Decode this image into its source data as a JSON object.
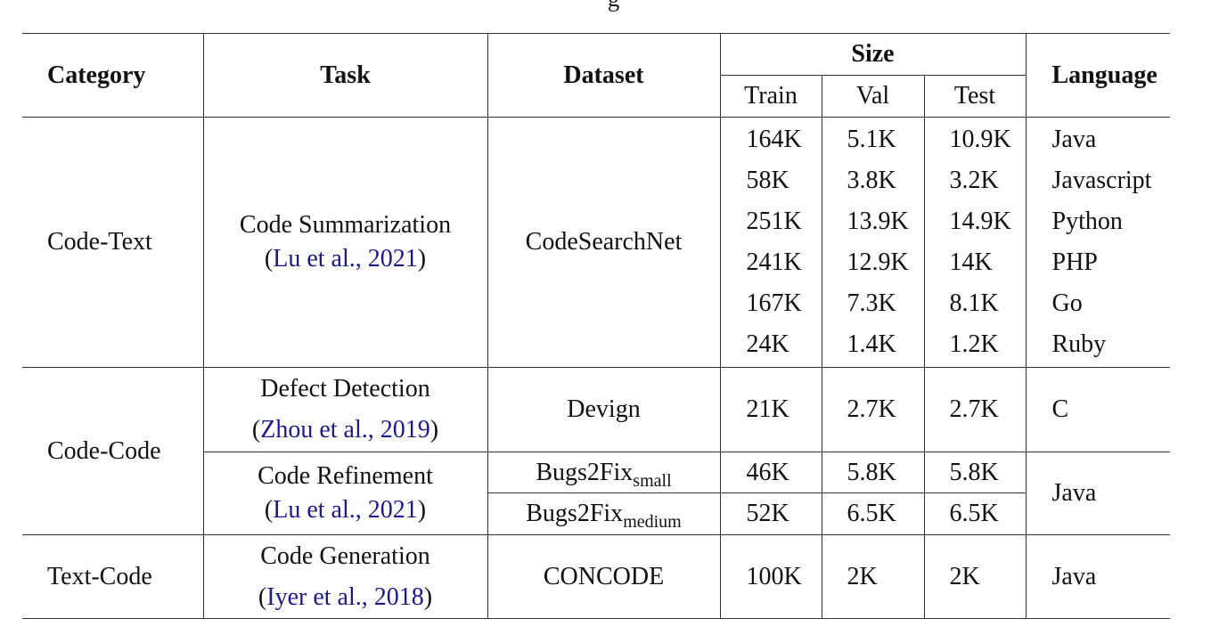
{
  "caption_fragment": "g",
  "header": {
    "category": "Category",
    "task": "Task",
    "dataset": "Dataset",
    "size": "Size",
    "train": "Train",
    "val": "Val",
    "test": "Test",
    "language": "Language"
  },
  "rows": {
    "code_text": {
      "category": "Code-Text",
      "task": "Code Summarization",
      "cite_open": "(",
      "cite": "Lu et al., 2021",
      "cite_close": ")",
      "dataset": "CodeSearchNet",
      "entries": [
        {
          "train": "164K",
          "val": "5.1K",
          "test": "10.9K",
          "language": "Java"
        },
        {
          "train": "58K",
          "val": "3.8K",
          "test": "3.2K",
          "language": "Javascript"
        },
        {
          "train": "251K",
          "val": "13.9K",
          "test": "14.9K",
          "language": "Python"
        },
        {
          "train": "241K",
          "val": "12.9K",
          "test": "14K",
          "language": "PHP"
        },
        {
          "train": "167K",
          "val": "7.3K",
          "test": "8.1K",
          "language": "Go"
        },
        {
          "train": "24K",
          "val": "1.4K",
          "test": "1.2K",
          "language": "Ruby"
        }
      ]
    },
    "code_code": {
      "category": "Code-Code",
      "defect": {
        "task": "Defect Detection",
        "cite_open": "(",
        "cite": "Zhou et al., 2019",
        "cite_close": ")",
        "dataset": "Devign",
        "train": "21K",
        "val": "2.7K",
        "test": "2.7K",
        "language": "C"
      },
      "refine": {
        "task": "Code Refinement",
        "cite_open": "(",
        "cite": "Lu et al., 2021",
        "cite_close": ")",
        "language": "Java",
        "small": {
          "dataset": "Bugs2Fix",
          "sub": "small",
          "train": "46K",
          "val": "5.8K",
          "test": "5.8K"
        },
        "medium": {
          "dataset": "Bugs2Fix",
          "sub": "medium",
          "train": "52K",
          "val": "6.5K",
          "test": "6.5K"
        }
      }
    },
    "text_code": {
      "category": "Text-Code",
      "task": "Code Generation",
      "cite_open": "(",
      "cite": "Iyer et al., 2018",
      "cite_close": ")",
      "dataset": "CONCODE",
      "train": "100K",
      "val": "2K",
      "test": "2K",
      "language": "Java"
    }
  }
}
